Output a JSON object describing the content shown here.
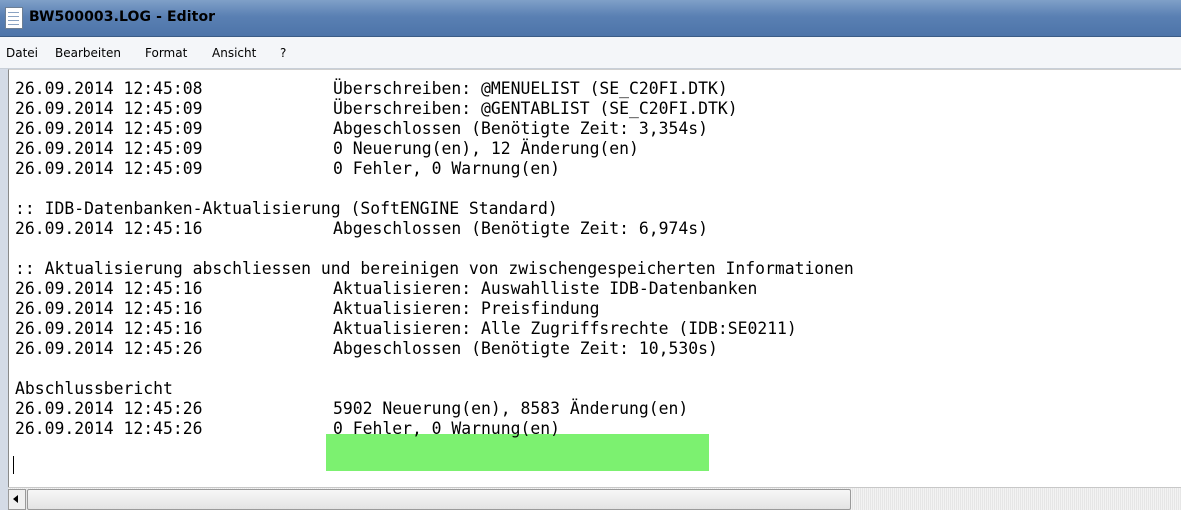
{
  "window": {
    "title": "BW500003.LOG - Editor",
    "icon": "notepad-icon"
  },
  "menu": {
    "items": [
      "Datei",
      "Bearbeiten",
      "Format",
      "Ansicht",
      "?"
    ]
  },
  "highlight_color": "#7cf170",
  "log": {
    "lines": [
      {
        "ts": "26.09.2014 12:45:08",
        "msg": "Überschreiben: @MENUELIST (SE_C20FI.DTK)"
      },
      {
        "ts": "26.09.2014 12:45:09",
        "msg": "Überschreiben: @GENTABLIST (SE_C20FI.DTK)"
      },
      {
        "ts": "26.09.2014 12:45:09",
        "msg": "Abgeschlossen (Benötigte Zeit: 3,354s)"
      },
      {
        "ts": "26.09.2014 12:45:09",
        "msg": "0 Neuerung(en), 12 Änderung(en)"
      },
      {
        "ts": "26.09.2014 12:45:09",
        "msg": "0 Fehler, 0 Warnung(en)"
      },
      {
        "ts": "",
        "msg": ""
      },
      {
        "ts": ":: IDB-Datenbanken-Aktualisierung (SoftENGINE Standard)",
        "msg": ""
      },
      {
        "ts": "26.09.2014 12:45:16",
        "msg": "Abgeschlossen (Benötigte Zeit: 6,974s)"
      },
      {
        "ts": "",
        "msg": ""
      },
      {
        "ts": ":: Aktualisierung abschliessen und bereinigen von zwischengespeicherten Informationen",
        "msg": ""
      },
      {
        "ts": "26.09.2014 12:45:16",
        "msg": "Aktualisieren: Auswahlliste IDB-Datenbanken"
      },
      {
        "ts": "26.09.2014 12:45:16",
        "msg": "Aktualisieren: Preisfindung"
      },
      {
        "ts": "26.09.2014 12:45:16",
        "msg": "Aktualisieren: Alle Zugriffsrechte (IDB:SE0211)"
      },
      {
        "ts": "26.09.2014 12:45:26",
        "msg": "Abgeschlossen (Benötigte Zeit: 10,530s)"
      },
      {
        "ts": "",
        "msg": ""
      },
      {
        "ts": "Abschlussbericht",
        "msg": ""
      },
      {
        "ts": "26.09.2014 12:45:26",
        "msg": "5902 Neuerung(en), 8583 Änderung(en)"
      },
      {
        "ts": "26.09.2014 12:45:26",
        "msg": "0 Fehler, 0 Warnung(en)"
      }
    ]
  }
}
